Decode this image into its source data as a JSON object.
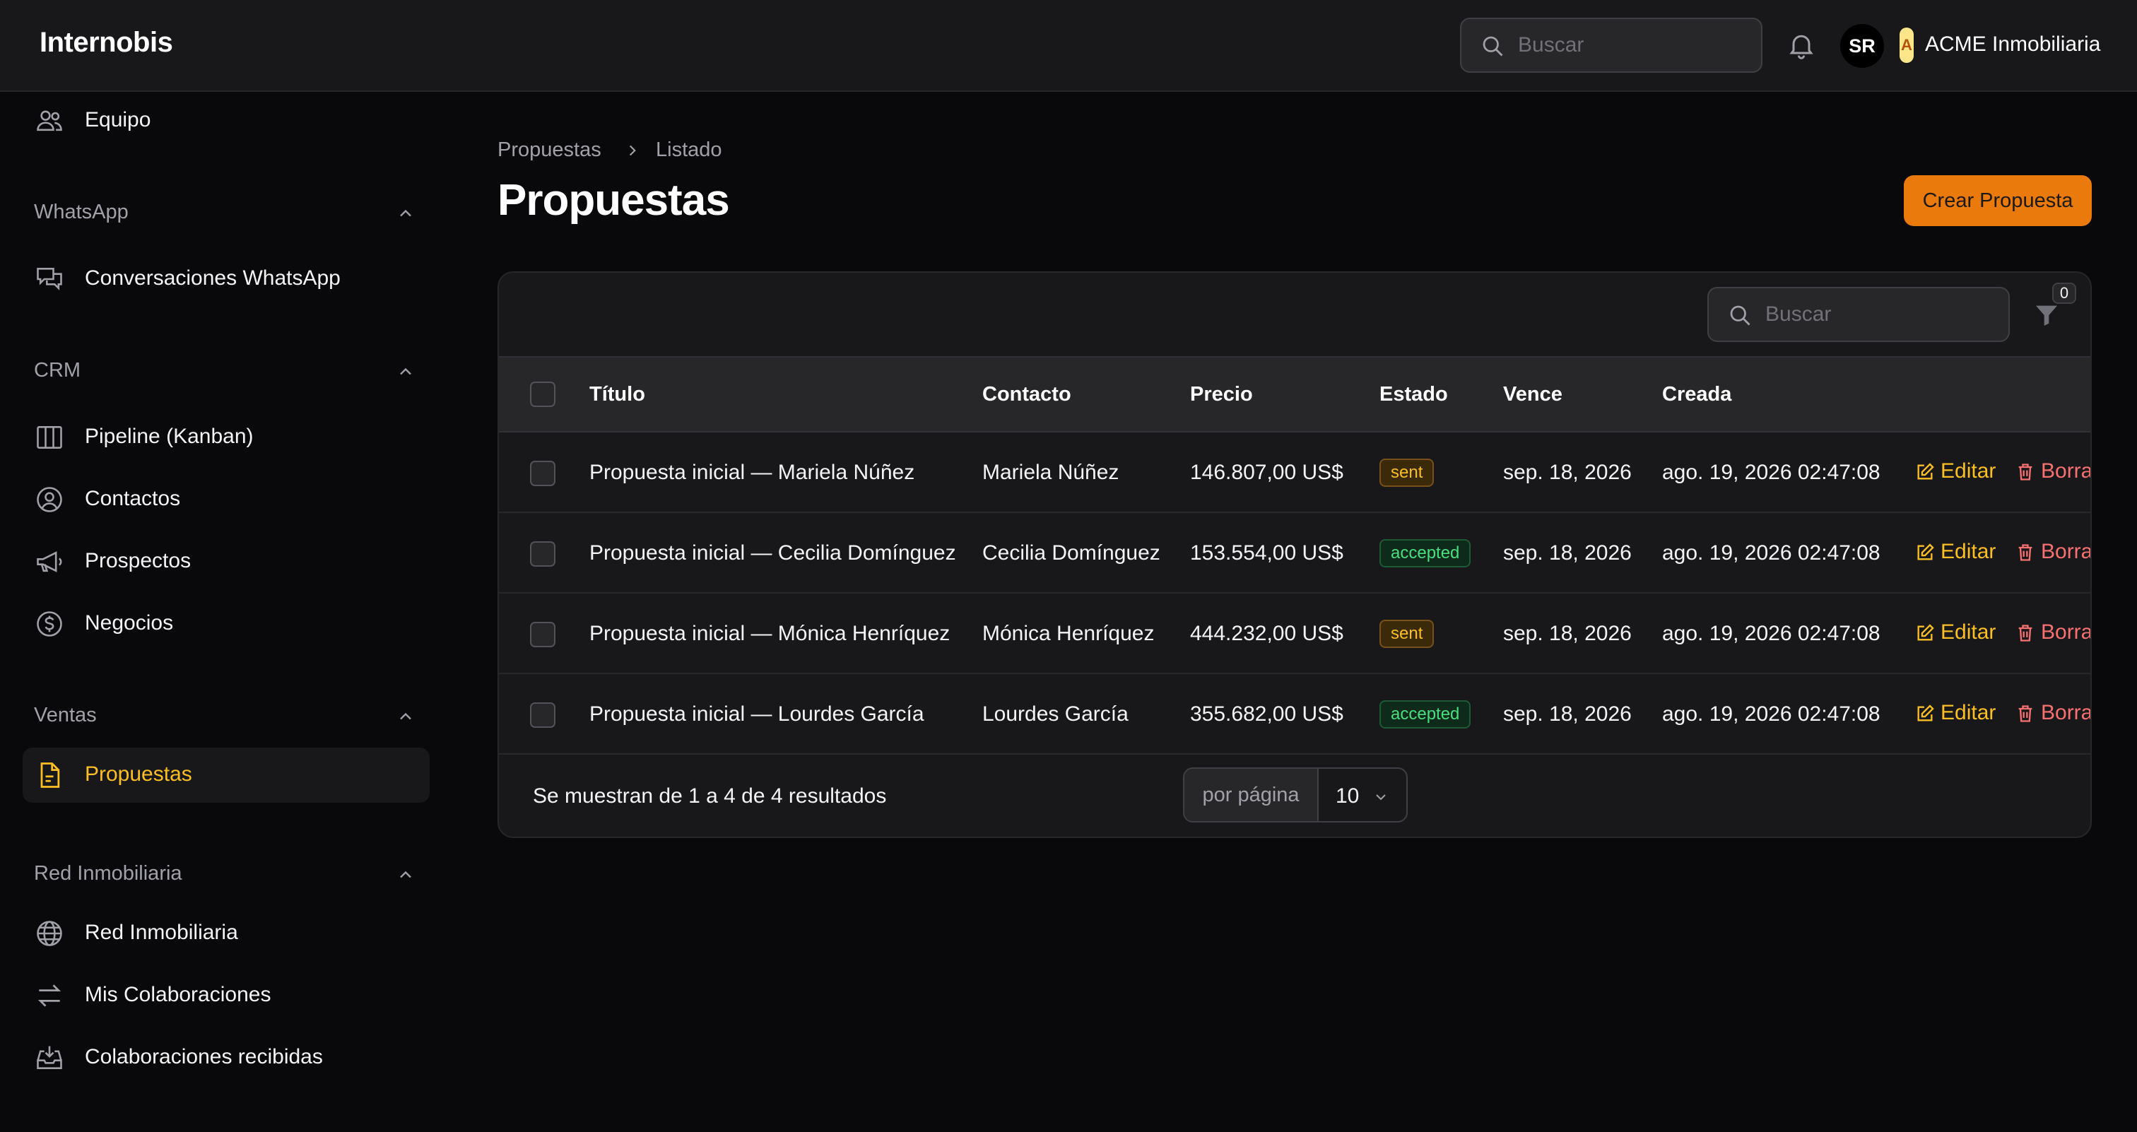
{
  "app": {
    "brand": "Internobis",
    "search_placeholder": "Buscar",
    "user_initials": "SR",
    "tenant_badge": "A",
    "tenant_name": "ACME Inmobiliaria"
  },
  "sidebar": {
    "top_item": {
      "label": "Equipo",
      "icon": "users-icon"
    },
    "groups": [
      {
        "label": "WhatsApp",
        "items": [
          {
            "label": "Conversaciones WhatsApp",
            "icon": "chat-bubbles-icon"
          }
        ]
      },
      {
        "label": "CRM",
        "items": [
          {
            "label": "Pipeline (Kanban)",
            "icon": "kanban-icon"
          },
          {
            "label": "Contactos",
            "icon": "user-circle-icon"
          },
          {
            "label": "Prospectos",
            "icon": "megaphone-icon"
          },
          {
            "label": "Negocios",
            "icon": "dollar-circle-icon"
          }
        ]
      },
      {
        "label": "Ventas",
        "items": [
          {
            "label": "Propuestas",
            "icon": "document-icon",
            "active": true
          }
        ]
      },
      {
        "label": "Red Inmobiliaria",
        "items": [
          {
            "label": "Red Inmobiliaria",
            "icon": "globe-icon"
          },
          {
            "label": "Mis Colaboraciones",
            "icon": "arrows-exchange-icon"
          },
          {
            "label": "Colaboraciones recibidas",
            "icon": "inbox-download-icon"
          }
        ]
      }
    ]
  },
  "main": {
    "breadcrumb": [
      "Propuestas",
      "Listado"
    ],
    "title": "Propuestas",
    "create_label": "Crear Propuesta",
    "table_search_placeholder": "Buscar",
    "filter_count": "0",
    "columns": [
      "Título",
      "Contacto",
      "Precio",
      "Estado",
      "Vence",
      "Creada"
    ],
    "rows": [
      {
        "title": "Propuesta inicial — Mariela Núñez",
        "contact": "Mariela Núñez",
        "price": "146.807,00 US$",
        "status": "sent",
        "due": "sep. 18, 2026",
        "created": "ago. 19, 2026 02:47:08"
      },
      {
        "title": "Propuesta inicial — Cecilia Domínguez",
        "contact": "Cecilia Domínguez",
        "price": "153.554,00 US$",
        "status": "accepted",
        "due": "sep. 18, 2026",
        "created": "ago. 19, 2026 02:47:08"
      },
      {
        "title": "Propuesta inicial — Mónica Henríquez",
        "contact": "Mónica Henríquez",
        "price": "444.232,00 US$",
        "status": "sent",
        "due": "sep. 18, 2026",
        "created": "ago. 19, 2026 02:47:08"
      },
      {
        "title": "Propuesta inicial — Lourdes García",
        "contact": "Lourdes García",
        "price": "355.682,00 US$",
        "status": "accepted",
        "due": "sep. 18, 2026",
        "created": "ago. 19, 2026 02:47:08"
      }
    ],
    "edit_label": "Editar",
    "delete_label": "Borra",
    "results_text": "Se muestran de 1 a 4 de 4 resultados",
    "per_page_label": "por página",
    "per_page_value": "10"
  },
  "colors": {
    "accent": "#ea7a0c",
    "active_text": "#fbbf24",
    "danger": "#f87171",
    "success": "#4ade80"
  }
}
